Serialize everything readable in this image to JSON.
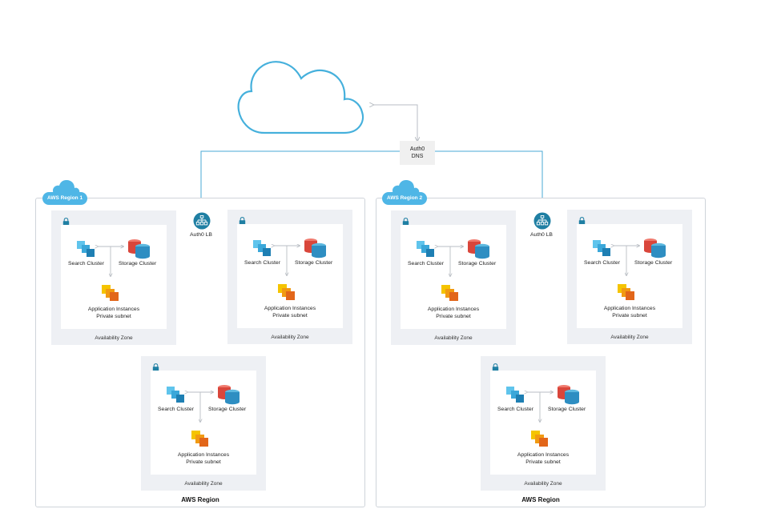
{
  "dns": {
    "line1": "Auth0",
    "line2": "DNS"
  },
  "regions": [
    {
      "tag": "AWS Region 1",
      "footer": "AWS Region",
      "lb_label": "Auth0 LB"
    },
    {
      "tag": "AWS Region 2",
      "footer": "AWS Region",
      "lb_label": "Auth0 LB"
    }
  ],
  "zone": {
    "search_label": "Search Cluster",
    "storage_label": "Storage Cluster",
    "app_line1": "Application Instances",
    "app_line2": "Private subnet",
    "zone_label": "Availability Zone"
  },
  "colors": {
    "connector": "#4aa9d6",
    "cloud_outline": "#45b0dc",
    "region_tag": "#4fb6e6",
    "zone_bg": "#eef0f4",
    "lb_circle": "#1f7fa3"
  },
  "icons": [
    "cloud-icon",
    "lock-icon",
    "search-cluster-icon",
    "storage-cluster-icon",
    "application-instances-icon",
    "load-balancer-icon"
  ]
}
